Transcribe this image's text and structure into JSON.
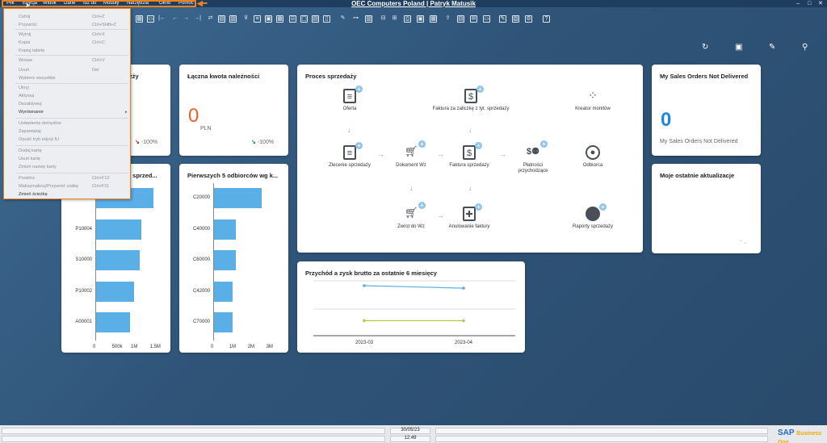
{
  "menu": {
    "items": [
      "Plik",
      "Edycja",
      "Widok",
      "Dane",
      "Idź do",
      "Moduły",
      "Narzędzia",
      "Okno",
      "Pomoc"
    ],
    "window_title": "OEC Computers Poland | Patryk Matusik",
    "controls": [
      "–",
      "□",
      "✕"
    ]
  },
  "edit_menu": {
    "items": [
      {
        "label": "Cofnij",
        "shortcut": "Ctrl+Z"
      },
      {
        "label": "Przywróć",
        "shortcut": "Ctrl+Shift+Z"
      },
      {
        "label": "Wytnij",
        "shortcut": "Ctrl+X"
      },
      {
        "label": "Kopia",
        "shortcut": "Ctrl+C"
      },
      {
        "label": "Kopiuj tabelę",
        "shortcut": ""
      },
      {
        "label": "Wstaw",
        "shortcut": "Ctrl+V"
      },
      {
        "label": "Usuń",
        "shortcut": "Del"
      },
      {
        "label": "Wybierz wszystkie",
        "shortcut": ""
      },
      {
        "label": "Ukryj",
        "shortcut": ""
      },
      {
        "label": "Aktywuj",
        "shortcut": ""
      },
      {
        "label": "Dezaktywuj",
        "shortcut": ""
      },
      {
        "label": "Wyrównanie",
        "shortcut": ""
      },
      {
        "label": "Ustawienia domyślne",
        "shortcut": ""
      },
      {
        "label": "Zapamiętaj",
        "shortcut": ""
      },
      {
        "label": "Opuść tryb edycji IU",
        "shortcut": ""
      },
      {
        "label": "Dodaj kartę",
        "shortcut": ""
      },
      {
        "label": "Usuń kartę",
        "shortcut": ""
      },
      {
        "label": "Zmień nazwę karty",
        "shortcut": ""
      },
      {
        "label": "Powtórz",
        "shortcut": "Ctrl+F12"
      },
      {
        "label": "Maksymalizuj/Przywróć siatkę",
        "shortcut": "Ctrl+F11"
      },
      {
        "label": "Zmień ścieżkę",
        "shortcut": ""
      }
    ]
  },
  "cards": {
    "sales_partial_title": "żży",
    "sales_trend": "-100%",
    "receivables": {
      "title": "Łączna kwota należności",
      "value": "0",
      "currency": "PLN",
      "trend": "-100%"
    },
    "not_delivered": {
      "title": "My Sales Orders Not Delivered",
      "value": "0",
      "caption": "My Sales Orders Not Delivered"
    },
    "latest_updates": {
      "title": "Moje ostatnie aktualizacje"
    },
    "top_items_title": "j sprzed...",
    "top_customers_title": "Pierwszych 5 odbiorców wg k...",
    "revenue_title": "Przychód a zysk brutto za ostatnie 6 miesięcy"
  },
  "process": {
    "title": "Proces sprzedaży",
    "nodes": {
      "offer": "Oferta",
      "advance_invoice": "Faktura za zaliczkę z tyt. sprzedaży",
      "dunning": "Kreator monitów",
      "sales_order": "Zlecenie sprzedaży",
      "delivery": "Dokument Wz",
      "invoice": "Faktura sprzedaży",
      "incoming_payments": "Płatności przychodzące",
      "customer": "Odbiorca",
      "return": "Zwrot do Wz",
      "cancel_invoice": "Anulowanie faktury",
      "sales_reports": "Raporty sprzedaży"
    }
  },
  "chart_data": [
    {
      "type": "bar",
      "title": "",
      "categories": [
        "",
        "P10004",
        "S10000",
        "P10002",
        "A00001"
      ],
      "values": [
        1.5,
        1.2,
        1.15,
        1.0,
        0.9
      ],
      "xticks": [
        "0",
        "500k",
        "1M",
        "1.5M"
      ],
      "xlim": [
        0,
        1.7
      ]
    },
    {
      "type": "bar",
      "title": "Pierwszych 5 odbiorców wg k...",
      "categories": [
        "C20000",
        "C40000",
        "C60000",
        "C42000",
        "C70000"
      ],
      "values": [
        2.6,
        1.2,
        1.2,
        1.0,
        1.0
      ],
      "xticks": [
        "0",
        "1M",
        "2M",
        "3M"
      ],
      "xlim": [
        0,
        3.5
      ]
    },
    {
      "type": "line",
      "title": "Przychód a zysk brutto za ostatnie 6 miesięcy",
      "categories": [
        "2023-03",
        "2023-04"
      ],
      "series": [
        {
          "values": [
            100,
            95
          ],
          "color": "#5aafe6"
        },
        {
          "values": [
            30,
            30
          ],
          "color": "#b6c94e"
        }
      ]
    }
  ],
  "status": {
    "date": "30/05/23",
    "time": "12:49",
    "logo": "SAP",
    "logo_sub": "Business One"
  }
}
